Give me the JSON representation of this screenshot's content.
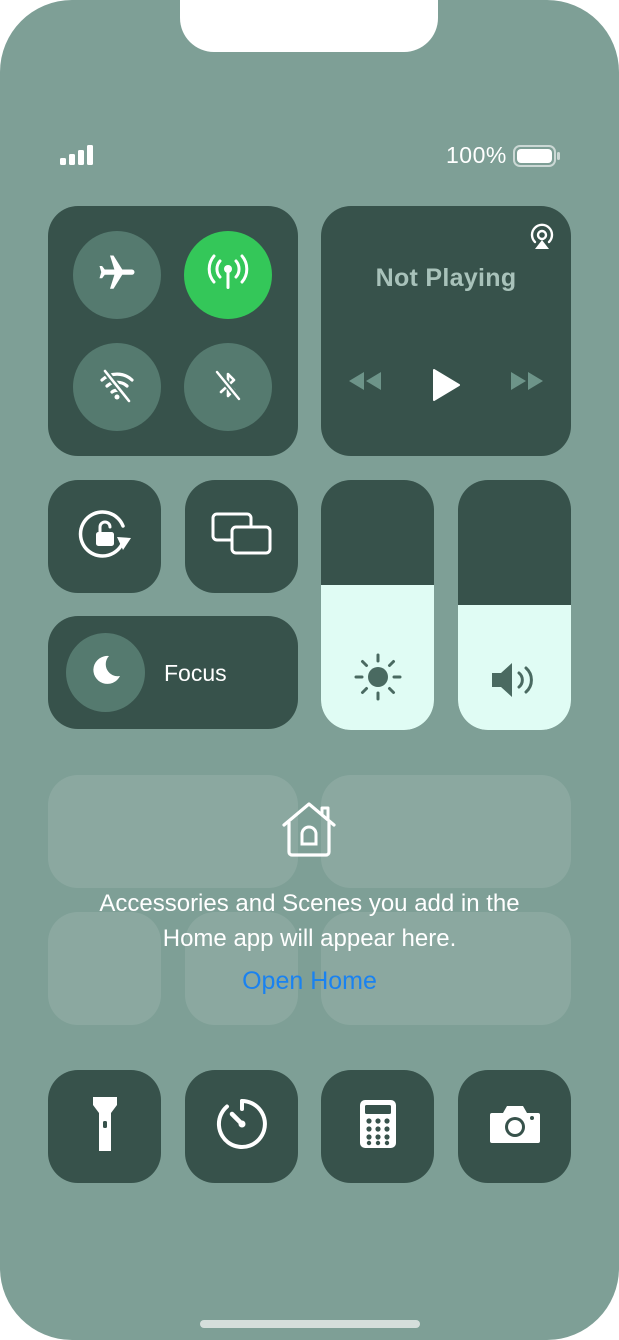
{
  "status_bar": {
    "battery_text": "100%",
    "battery_level": 1.0
  },
  "connectivity": {
    "airplane": {
      "on": false
    },
    "cellular": {
      "on": true
    },
    "wifi": {
      "on": false
    },
    "bluetooth": {
      "on": false
    }
  },
  "media": {
    "title": "Not Playing"
  },
  "focus": {
    "label": "Focus"
  },
  "brightness": {
    "level": 0.58
  },
  "volume": {
    "level": 0.5
  },
  "home": {
    "message_line1": "Accessories and Scenes you add in the",
    "message_line2": "Home app will appear here.",
    "link": "Open Home"
  },
  "colors": {
    "background": "#7e9f96",
    "tile": "#37524b",
    "circle": "#557a6f",
    "active_green": "#34c759",
    "slider_fill": "#e0fcf4",
    "link_blue": "#1a82f0"
  }
}
